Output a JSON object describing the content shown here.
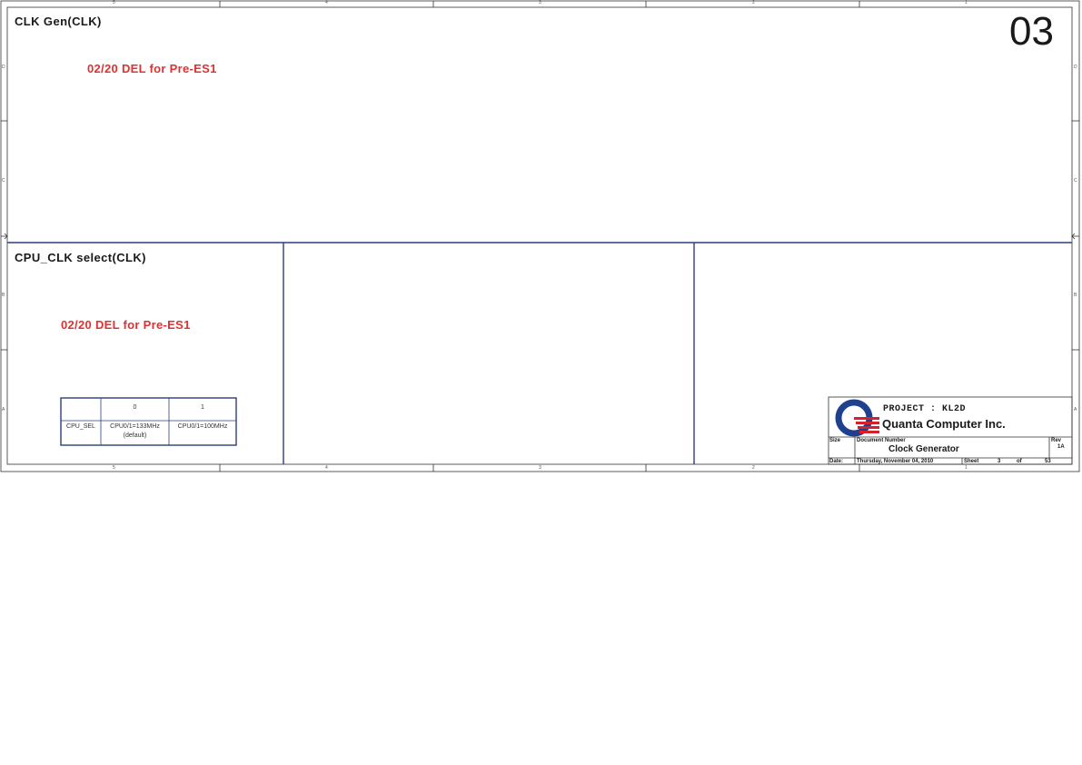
{
  "sheet": {
    "number": "03",
    "border_color": "#2b3f7a",
    "zone_columns_top": [
      "5",
      "4",
      "3",
      "2",
      "1"
    ],
    "zone_columns_bottom": [
      "5",
      "4",
      "3",
      "2",
      "1"
    ],
    "zone_rows": [
      "D",
      "C",
      "B",
      "A"
    ]
  },
  "sections": {
    "clk_gen": {
      "title": "CLK Gen(CLK)",
      "note": "02/20 DEL for Pre-ES1"
    },
    "cpu_clk_select": {
      "title": "CPU_CLK select(CLK)",
      "note": "02/20 DEL for Pre-ES1",
      "table": {
        "header": [
          "",
          "0",
          "1"
        ],
        "row_label": "CPU_SEL",
        "row_value_0": "CPU0/1=133MHz",
        "row_value_0_sub": "(default)",
        "row_value_1": "CPU0/1=100MHz"
      }
    }
  },
  "title_block": {
    "project": "PROJECT : KL2D",
    "company": "Quanta Computer Inc.",
    "size_label": "Size",
    "doc_number_label": "Document Number",
    "doc_name": "Clock Generator",
    "rev_label": "Rev",
    "rev_value": "1A",
    "date_label": "Date:",
    "date_value": "Thursday, November 04, 2010",
    "sheet_label": "Sheet",
    "sheet_current": "3",
    "of_label": "of",
    "sheet_total": "53",
    "logo_colors": {
      "blue": "#1f3f8f",
      "red": "#d8202a"
    }
  },
  "colors": {
    "note_red": "#e03030"
  }
}
